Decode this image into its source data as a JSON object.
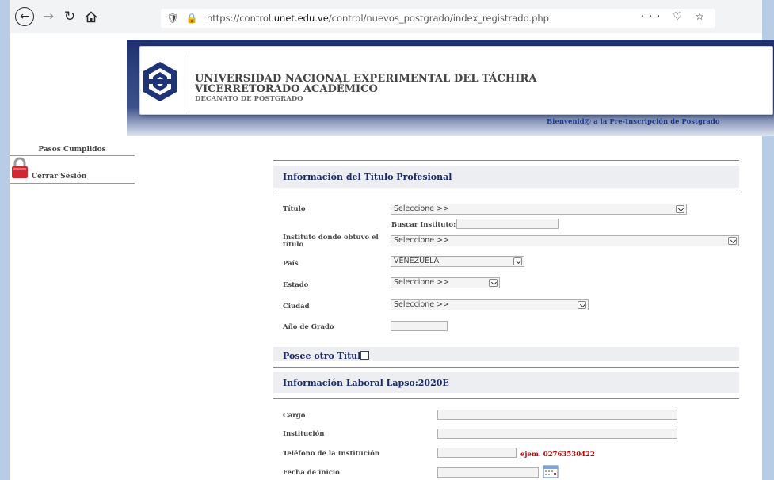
{
  "browser": {
    "url_prefix": "https://control.",
    "url_domain": "unet.edu.ve",
    "url_path": "/control/nuevos_postgrado/index_registrado.php",
    "actions": "··· ♡ ☆"
  },
  "header": {
    "university": "UNIVERSIDAD NACIONAL EXPERIMENTAL DEL TÁCHIRA",
    "vicerrectorado": "VICERRETORADO ACADÉMICO",
    "decanato": "DECANATO DE POSTGRADO",
    "welcome": "Bienvenid@ a la Pre-Inscripción de Postgrado"
  },
  "sidebar": {
    "title": "Pasos Cumplidos",
    "logout": "Cerrar Sesión",
    "lock_color": "#d22630"
  },
  "titulo_section": {
    "heading": "Información del Título Profesional",
    "fields": {
      "titulo_label": "Título",
      "titulo_value": "Seleccione >>",
      "buscar_label": "Buscar Instituto:",
      "instituto_label": "Instituto donde obtuvo el título",
      "instituto_value": "Seleccione >>",
      "pais_label": "País",
      "pais_value": "VENEZUELA",
      "estado_label": "Estado",
      "estado_value": "Seleccione >>",
      "ciudad_label": "Ciudad",
      "ciudad_value": "Seleccione >>",
      "anio_label": "Año de Grado"
    },
    "otro_titulo_label": "Posee otro Título"
  },
  "laboral_section": {
    "heading": "Información Laboral Lapso:2020E",
    "cargo_label": "Cargo",
    "institucion_label": "Institución",
    "telefono_label": "Teléfono de la Institución",
    "telefono_hint": "ejem. 02763530422",
    "fecha_label": "Fecha de inicio"
  },
  "colors": {
    "heading": "#1b2a6e",
    "hint": "#c00000",
    "banner": "#2e4380"
  }
}
